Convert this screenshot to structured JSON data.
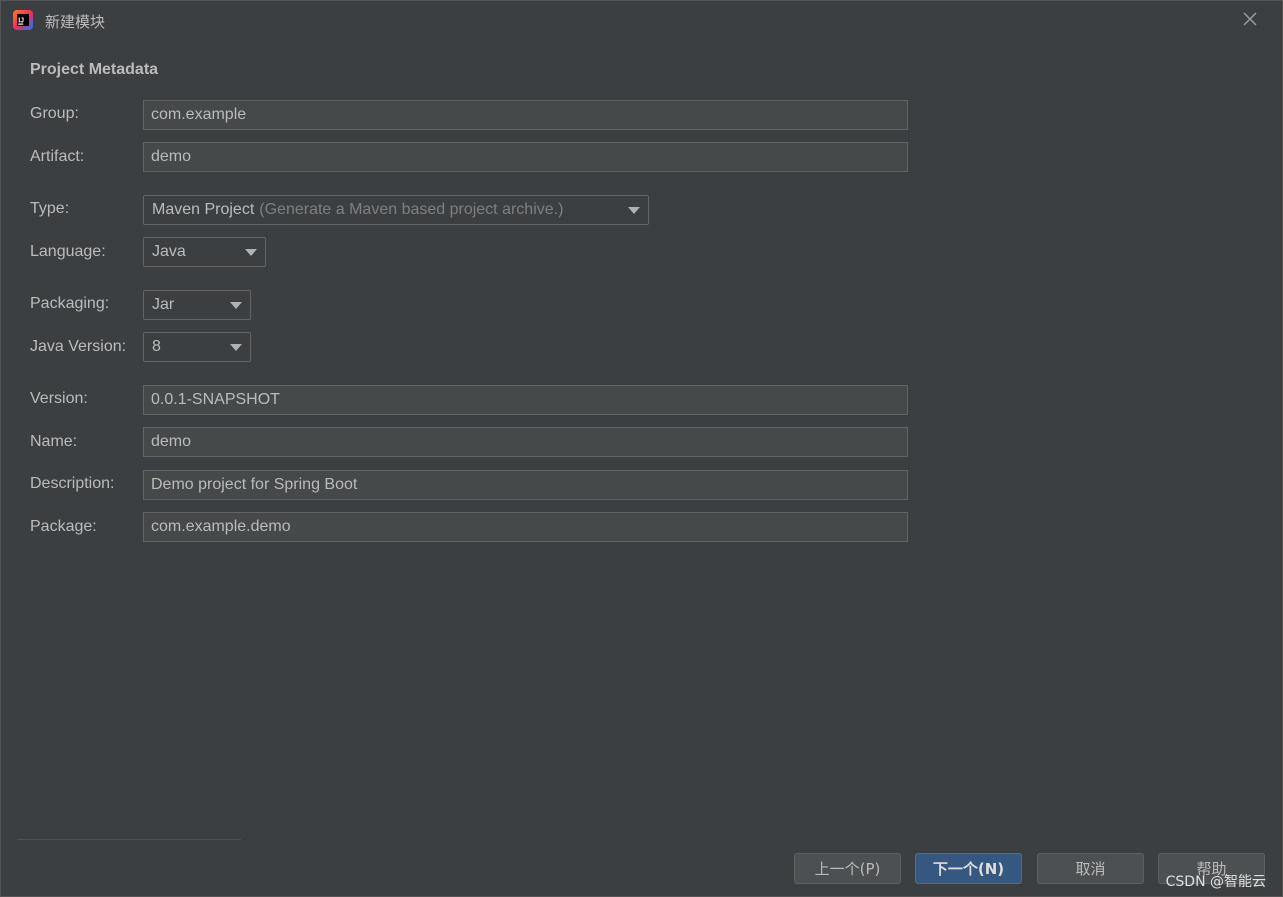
{
  "window": {
    "title": "新建模块"
  },
  "section": {
    "title": "Project Metadata"
  },
  "fields": {
    "group": {
      "label": "Group:",
      "value": "com.example"
    },
    "artifact": {
      "label": "Artifact:",
      "value": "demo"
    },
    "type": {
      "label": "Type:",
      "value": "Maven Project",
      "hint": "(Generate a Maven based project archive.)"
    },
    "language": {
      "label": "Language:",
      "value": "Java"
    },
    "packaging": {
      "label": "Packaging:",
      "value": "Jar"
    },
    "java_version": {
      "label": "Java Version:",
      "value": "8"
    },
    "version": {
      "label": "Version:",
      "value": "0.0.1-SNAPSHOT"
    },
    "name": {
      "label": "Name:",
      "value": "demo"
    },
    "description": {
      "label": "Description:",
      "value": "Demo project for Spring Boot"
    },
    "package": {
      "label": "Package:",
      "value": "com.example.demo"
    }
  },
  "buttons": {
    "previous": "上一个(P)",
    "next": "下一个(N)",
    "cancel": "取消",
    "help": "帮助"
  },
  "watermark": "CSDN @智能云",
  "icons": {
    "app": "intellij-idea-icon",
    "close": "close-icon",
    "dropdown": "chevron-down-icon"
  },
  "colors": {
    "background": "#3c3f41",
    "field_background": "#45494a",
    "primary_button": "#365880"
  }
}
